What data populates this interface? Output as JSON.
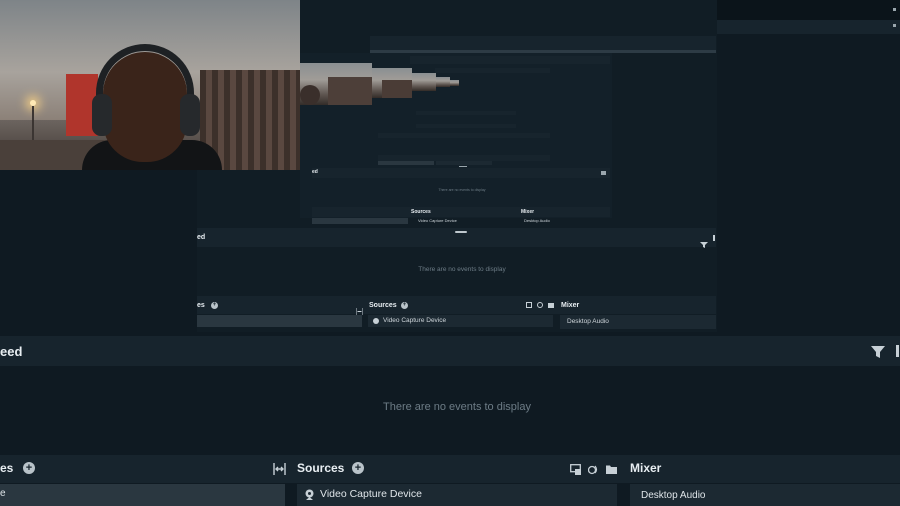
{
  "feed": {
    "title": "eed",
    "empty_message": "There are no events to display"
  },
  "scenes": {
    "title": "es",
    "item": "e"
  },
  "sources": {
    "title": "Sources",
    "item": "Video Capture Device"
  },
  "mixer": {
    "title": "Mixer",
    "item": "Desktop Audio"
  },
  "nested": {
    "feed_title": "ed",
    "empty_message": "There are no events to display",
    "scenes_title": "es",
    "sources_title": "Sources",
    "source_item": "Video Capture Device",
    "mixer_title": "Mixer",
    "mixer_item": "Desktop Audio"
  },
  "nested2": {
    "feed_title": "ed",
    "sources_title": "Sources",
    "source_item": "Video Capture Device",
    "mixer_title": "Mixer",
    "mixer_item": "Desktop Audio"
  },
  "icons": {
    "add": "plus-circle-icon",
    "filter": "filter-icon",
    "collapse": "collapse-horizontal-icon",
    "webcam": "webcam-icon",
    "studio_mode": "studio-mode-icon",
    "audio": "audio-settings-icon",
    "folder": "folder-icon"
  },
  "colors": {
    "background": "#0f1a22",
    "panel_header": "#17242d",
    "text_muted": "#6d7c86",
    "row_selected": "#2a3740"
  }
}
